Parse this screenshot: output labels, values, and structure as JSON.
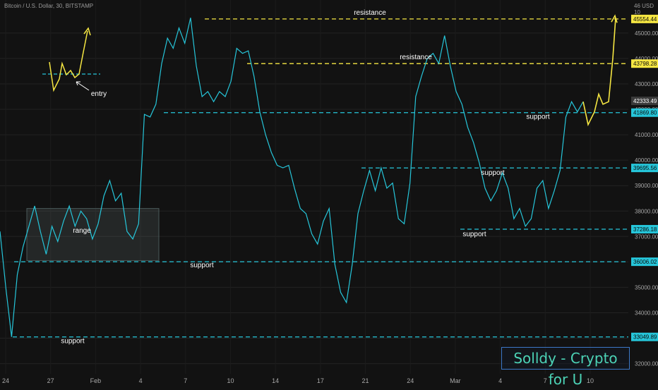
{
  "header": {
    "title": "Bitcoin / U.S. Dollar, 30, BITSTAMP",
    "unit": "46 USD 10"
  },
  "watermark": "Solldy - Crypto for U",
  "colors": {
    "price": "#26c6da",
    "support": "#26c6da",
    "resistance": "#f5e642",
    "projection": "#f5e642",
    "box": "#4a5a5a"
  },
  "chart_data": {
    "type": "line",
    "x_ticks": [
      "24",
      "27",
      "Feb",
      "4",
      "7",
      "10",
      "14",
      "17",
      "21",
      "24",
      "Mar",
      "4",
      "7",
      "10"
    ],
    "y_ticks": [
      32000,
      33000,
      34000,
      35000,
      36000,
      37000,
      38000,
      39000,
      40000,
      41000,
      42000,
      43000,
      44000,
      45000
    ],
    "ylim": [
      31600,
      46300
    ],
    "price_labels": [
      "45554.44",
      "43798.28",
      "42333.49",
      "41869.80",
      "39695.56",
      "37286.18",
      "36006.02",
      "33049.89"
    ],
    "series": [
      {
        "values": [
          37200,
          35000,
          33050,
          35500,
          36600,
          37400,
          38200,
          37200,
          36300,
          37400,
          36800,
          37600,
          38200,
          37400,
          38000,
          37700,
          36900,
          37500,
          38600,
          39200,
          38400,
          38700,
          37200,
          36900,
          37500,
          41800,
          41700,
          42200,
          43800,
          44800,
          44400,
          45200,
          44600,
          45600,
          43700,
          42500,
          42700,
          42300,
          42700,
          42500,
          43100,
          44400,
          44200,
          44300,
          43300,
          41900,
          41000,
          40300,
          39800,
          39700,
          39800,
          38900,
          38100,
          37900,
          37100,
          36700,
          37600,
          38100,
          35900,
          34800,
          34400,
          35900,
          37900,
          38800,
          39600,
          38800,
          39700,
          38900,
          39100,
          37700,
          37500,
          39100,
          42500,
          43300,
          44000,
          44200,
          43800,
          44900,
          43700,
          42700,
          42200,
          41300,
          40700,
          39900,
          38900,
          38400,
          38800,
          39500,
          38900,
          37700,
          38100,
          37400,
          37700,
          38900,
          39200,
          38100,
          38800,
          39600,
          41700,
          42300,
          41900,
          42300
        ]
      }
    ],
    "support_levels": [
      41869.8,
      39695.56,
      37286.18,
      36006.02,
      33049.89
    ],
    "resistance_levels": [
      45554.44,
      43798.28
    ],
    "range_box": {
      "y_low": 36050,
      "y_high": 38100
    },
    "annotations": {
      "resistance": "resistance",
      "support": "support",
      "range": "range",
      "entry": "entry"
    }
  }
}
